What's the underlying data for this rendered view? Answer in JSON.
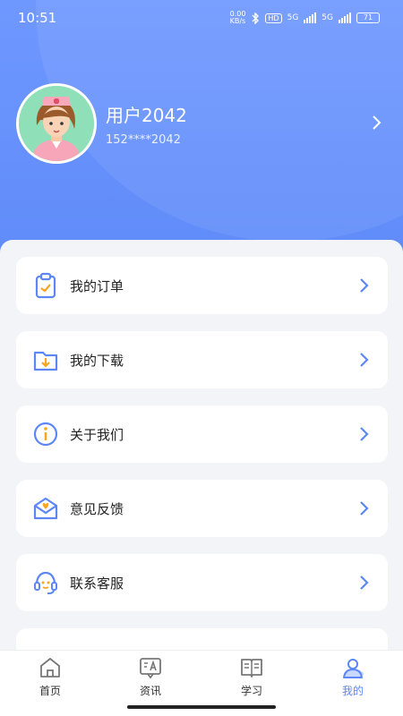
{
  "status_bar": {
    "time": "10:51",
    "net_speed": "0.00\nKB/s",
    "hd": "HD",
    "net1": "5G",
    "net2": "5G",
    "battery": "71"
  },
  "profile": {
    "username": "用户2042",
    "phone": "152****2042"
  },
  "menu": [
    {
      "label": "我的订单",
      "icon": "clipboard-check-icon"
    },
    {
      "label": "我的下载",
      "icon": "folder-download-icon"
    },
    {
      "label": "关于我们",
      "icon": "info-icon"
    },
    {
      "label": "意见反馈",
      "icon": "envelope-heart-icon"
    },
    {
      "label": "联系客服",
      "icon": "headset-icon"
    }
  ],
  "tabs": [
    {
      "label": "首页",
      "icon": "home-icon"
    },
    {
      "label": "资讯",
      "icon": "news-icon"
    },
    {
      "label": "学习",
      "icon": "book-icon"
    },
    {
      "label": "我的",
      "icon": "user-icon",
      "active": true
    }
  ],
  "colors": {
    "accent": "#5d86f6",
    "icon_orange": "#f5a623",
    "header_blue": "#6f98ff"
  }
}
